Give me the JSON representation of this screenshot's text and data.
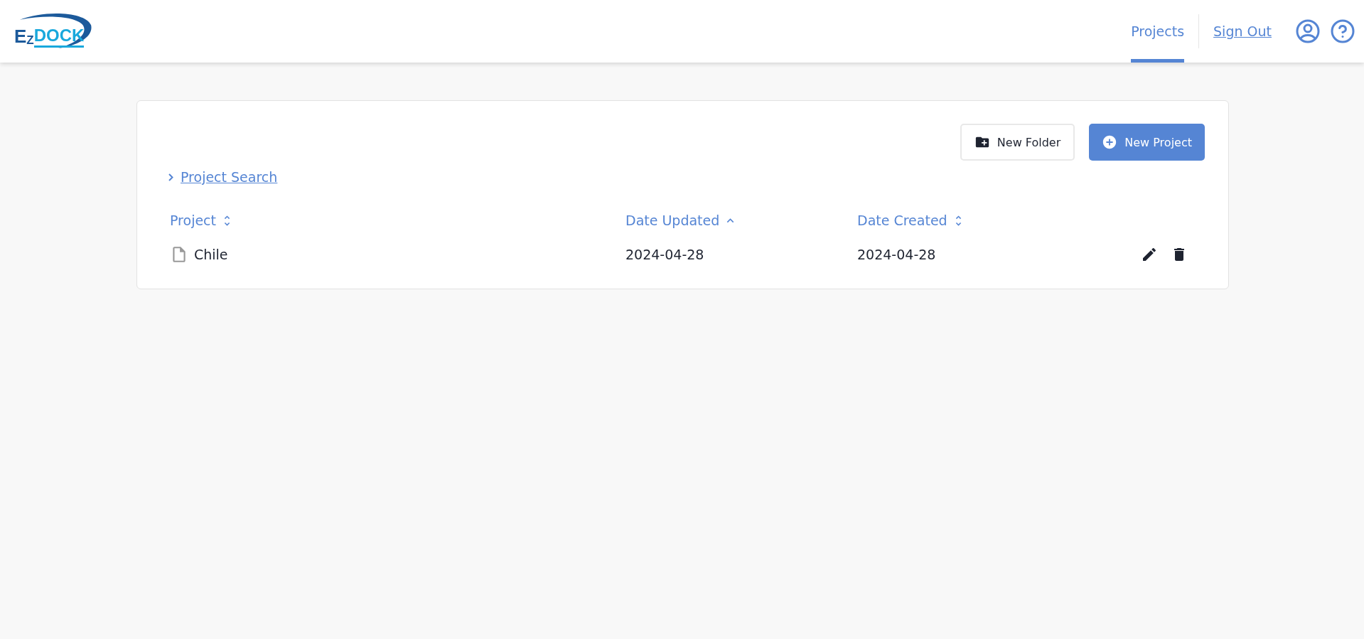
{
  "logo": {
    "letters": [
      "E",
      "Z",
      "DOCK"
    ]
  },
  "nav": [
    {
      "label": "Projects",
      "selected": true
    },
    {
      "label": "Sign Out",
      "selected": false
    }
  ],
  "toolbar": {
    "buttons": [
      {
        "label": "New Folder",
        "kind": "secondary"
      },
      {
        "label": "New Project",
        "kind": "primary"
      }
    ]
  },
  "search_toggle": {
    "label": "Project Search",
    "expanded": false
  },
  "table": {
    "columns": [
      {
        "label": "Project",
        "sorted": false
      },
      {
        "label": "Date Updated",
        "sorted": true
      },
      {
        "label": "Date Created",
        "sorted": false
      }
    ],
    "rows": [
      {
        "name": "Chile",
        "updated": "2024-04-28",
        "created": "2024-04-28"
      }
    ]
  }
}
